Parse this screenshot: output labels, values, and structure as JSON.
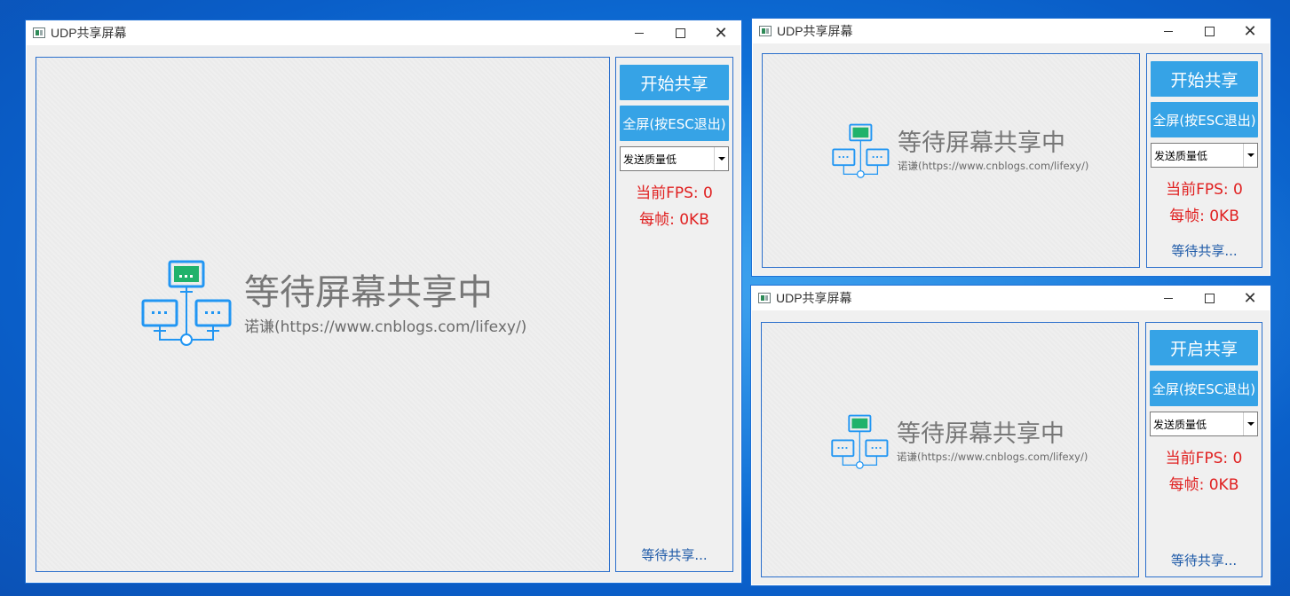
{
  "windows": [
    {
      "title": "UDP共享屏幕",
      "start_label": "开始共享",
      "fullscreen_label": "全屏(按ESC退出)",
      "quality": "发送质量低",
      "fps": "当前FPS: 0",
      "per_frame": "每帧: 0KB",
      "status": "等待共享...",
      "placeholder_title": "等待屏幕共享中",
      "placeholder_sub": "诺谦(https://www.cnblogs.com/lifexy/)"
    },
    {
      "title": "UDP共享屏幕",
      "start_label": "开始共享",
      "fullscreen_label": "全屏(按ESC退出)",
      "quality": "发送质量低",
      "fps": "当前FPS: 0",
      "per_frame": "每帧: 0KB",
      "status": "等待共享...",
      "placeholder_title": "等待屏幕共享中",
      "placeholder_sub": "诺谦(https://www.cnblogs.com/lifexy/)"
    },
    {
      "title": "UDP共享屏幕",
      "start_label": "开启共享",
      "fullscreen_label": "全屏(按ESC退出)",
      "quality": "发送质量低",
      "fps": "当前FPS: 0",
      "per_frame": "每帧: 0KB",
      "status": "等待共享...",
      "placeholder_title": "等待屏幕共享中",
      "placeholder_sub": "诺谦(https://www.cnblogs.com/lifexy/)"
    }
  ],
  "colors": {
    "accent_button": "#36a3e6",
    "stat_text": "#e02020",
    "status_text": "#1e5aa8",
    "icon_top": "#20b26b",
    "icon_lines": "#2196f3"
  },
  "icons": [
    "window-app-icon",
    "minimize-icon",
    "maximize-icon",
    "close-icon",
    "network-screens-icon",
    "chevron-down-icon"
  ]
}
